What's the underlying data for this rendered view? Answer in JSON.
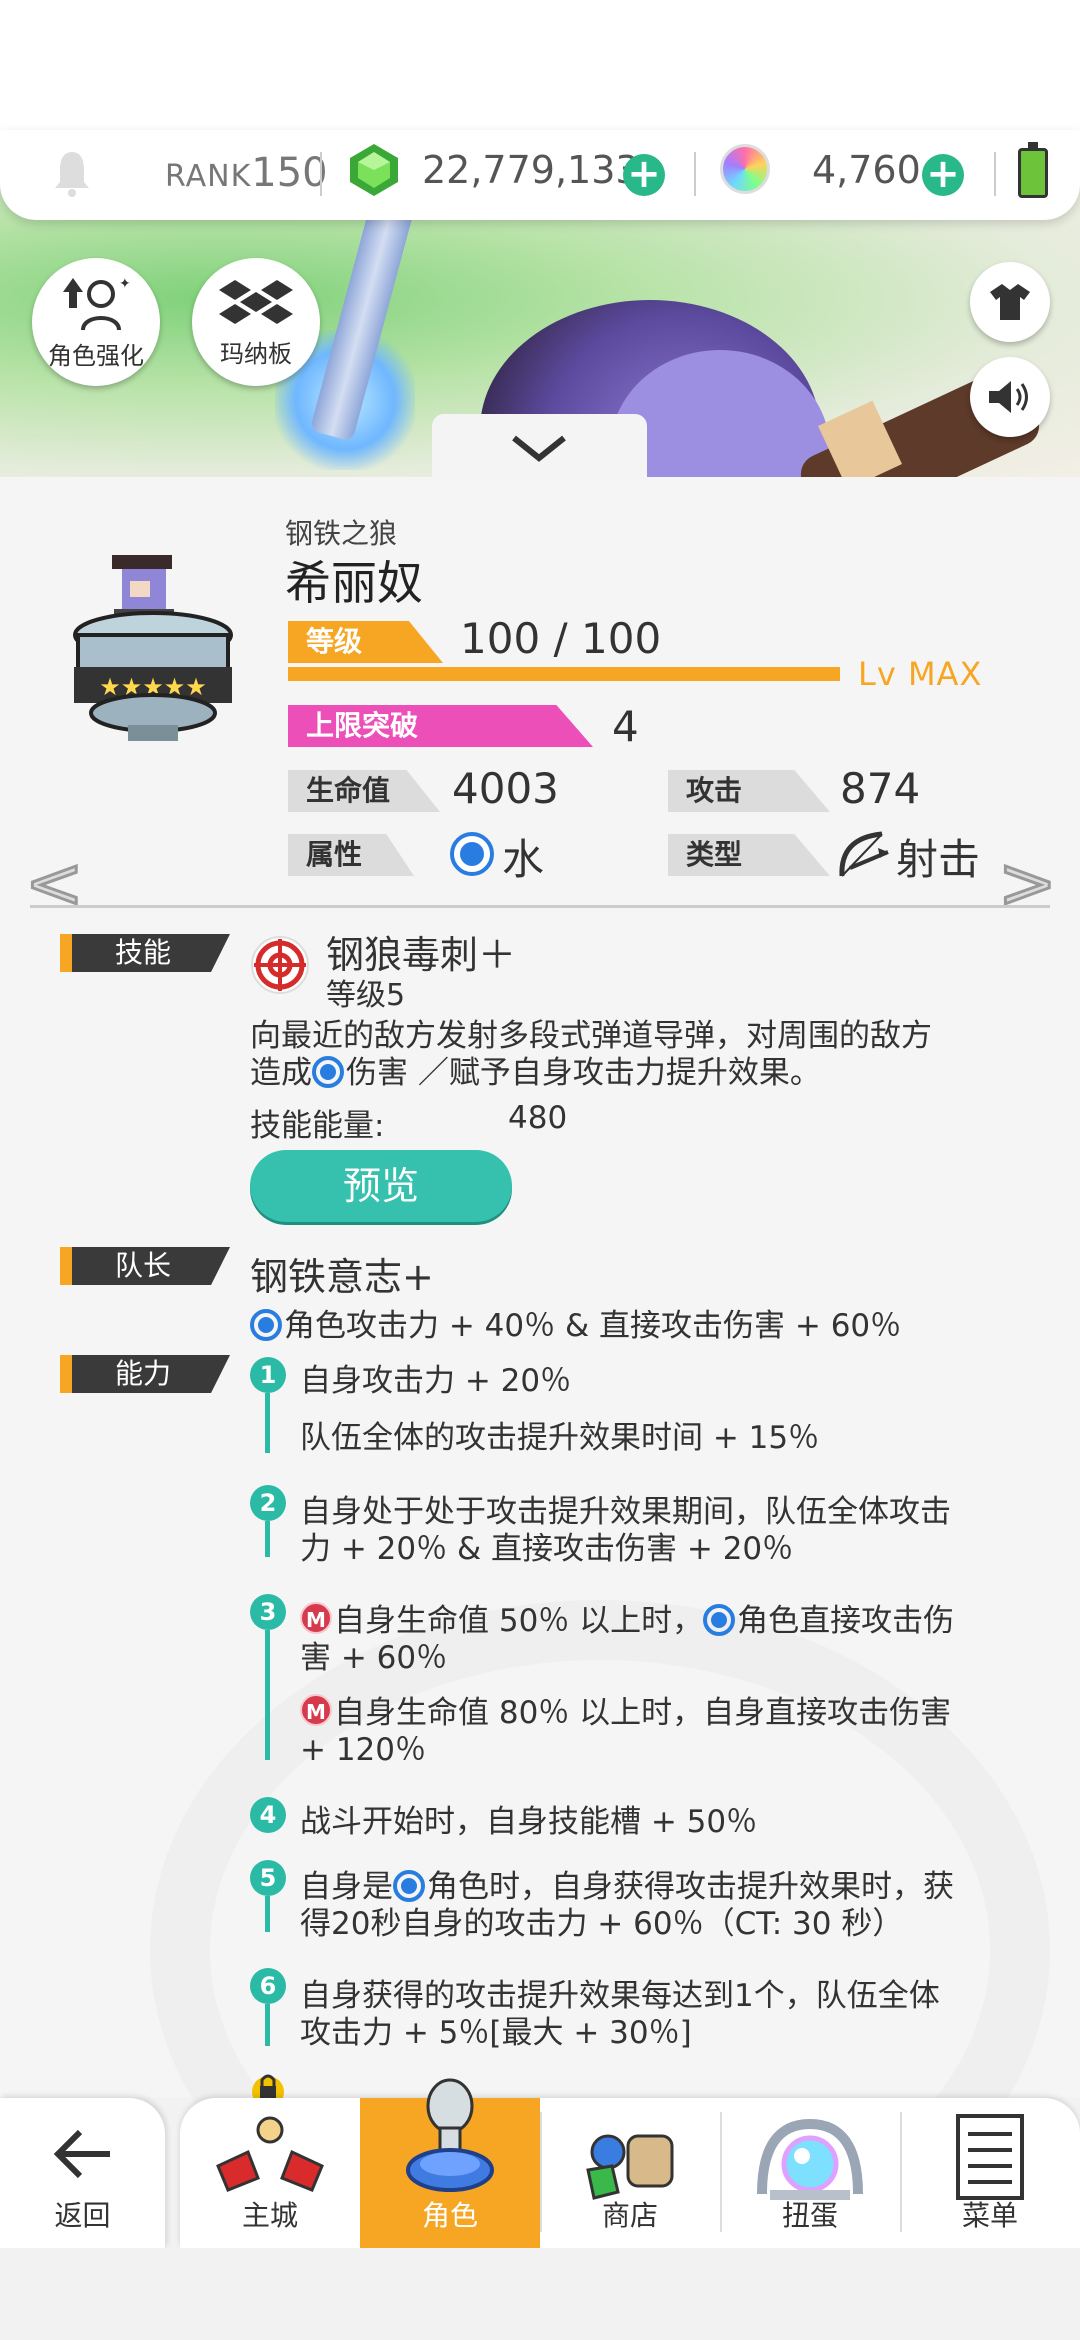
{
  "status": {
    "rank_label": "RANK",
    "rank_value": "150",
    "gold": "22,779,133",
    "orbs": "4,760"
  },
  "banner": {
    "btn_enhance": "角色强化",
    "btn_mana": "玛纳板"
  },
  "character": {
    "subtitle": "钢铁之狼",
    "name": "希丽奴",
    "level_label": "等级",
    "level_value": "100 / 100",
    "lv_max": "Lv MAX",
    "limit_label": "上限突破",
    "limit_value": "4",
    "hp_label": "生命值",
    "hp_value": "4003",
    "atk_label": "攻击",
    "atk_value": "874",
    "attr_label": "属性",
    "attr_value": "水",
    "type_label": "类型",
    "type_value": "射击"
  },
  "skill": {
    "section": "技能",
    "name": "钢狼毒刺＋",
    "level": "等级5",
    "desc_line1": "向最近的敌方发射多段式弹道导弹，对周围的敌方",
    "desc_line2_a": "造成",
    "desc_line2_b": "伤害 ／赋予自身攻击力提升效果。",
    "energy_label": "技能能量:",
    "energy_value": "480",
    "preview": "预览"
  },
  "leader": {
    "section": "队长",
    "name": "钢铁意志+",
    "desc": "角色攻击力 + 40％ & 直接攻击伤害 + 60％"
  },
  "ability": {
    "section": "能力",
    "items": [
      {
        "num": "1",
        "l1": "自身攻击力 + 20％",
        "l2": "队伍全体的攻击提升效果时间 + 15％"
      },
      {
        "num": "2",
        "l1": "自身处于处于攻击提升效果期间，队伍全体攻击",
        "l2": "力 + 20％ & 直接攻击伤害 + 20％"
      },
      {
        "num": "3",
        "l1a": "自身生命值 50％ 以上时，",
        "l1b": "角色直接攻击伤",
        "l2": "害 + 60％",
        "l3": "自身生命值 80％ 以上时，自身直接攻击伤害",
        "l4": "+ 120％"
      },
      {
        "num": "4",
        "l1": "战斗开始时，自身技能槽 + 50％"
      },
      {
        "num": "5",
        "l1a": "自身是",
        "l1b": "角色时，自身获得攻击提升效果时，获",
        "l2": "得20秒自身的攻击力 + 60％（CT: 30 秒）"
      },
      {
        "num": "6",
        "l1": "自身获得的攻击提升效果每达到1个，队伍全体",
        "l2": "攻击力 + 5％[最大 + 30％]"
      }
    ],
    "m_badge": "M"
  },
  "nav": {
    "back": "返回",
    "home": "主城",
    "chara": "角色",
    "shop": "商店",
    "gacha": "扭蛋",
    "menu": "菜单"
  }
}
